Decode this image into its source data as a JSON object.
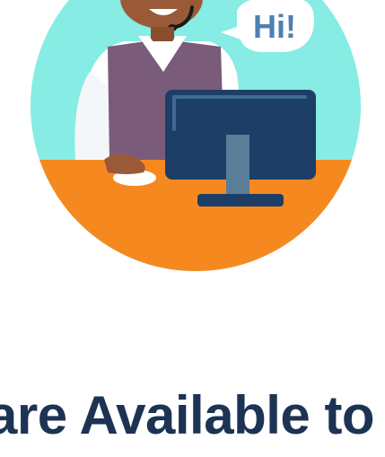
{
  "illustration": {
    "icon": "support-agent-illustration",
    "speech_bubble_text": "Hi!",
    "colors": {
      "background_circle": "#86ece4",
      "desk": "#f5891f",
      "vest": "#7a5b7a",
      "monitor": "#1d3e66",
      "monitor_stand": "#5a7e98",
      "skin": "#9b5a37",
      "speech_text": "#4f7fb3"
    }
  },
  "heading": {
    "text": "are Available to",
    "color": "#1c3354"
  }
}
